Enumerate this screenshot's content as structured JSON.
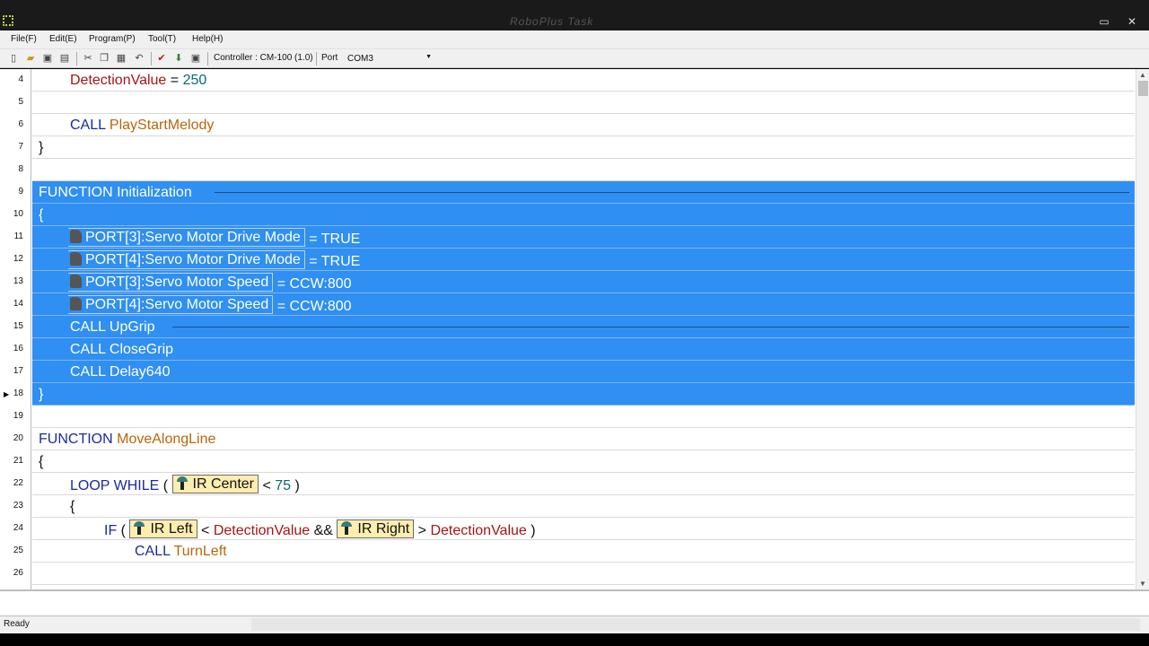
{
  "window": {
    "title": "RoboPlus Task"
  },
  "menu": [
    {
      "label": "File(F)"
    },
    {
      "label": "Edit(E)"
    },
    {
      "label": "Program(P)"
    },
    {
      "label": "Tool(T)"
    },
    {
      "label": "Help(H)"
    }
  ],
  "toolbar": {
    "controller_label": "Controller : CM-100 (1.0)",
    "port_label": "Port",
    "port_value": "COM3"
  },
  "editor": {
    "lines": [
      {
        "n": "4",
        "parts": [
          {
            "t": "DetectionValue",
            "c": "var"
          },
          {
            "t": " = ",
            "c": "op"
          },
          {
            "t": "250",
            "c": "num"
          }
        ]
      },
      {
        "n": "5",
        "parts": []
      },
      {
        "n": "6",
        "parts": [
          {
            "t": "CALL",
            "c": "kw"
          },
          {
            "t": "PlayStartMelody",
            "c": "fn"
          }
        ]
      },
      {
        "n": "7",
        "parts": [
          {
            "t": "}",
            "c": "op"
          }
        ]
      },
      {
        "n": "8",
        "parts": []
      },
      {
        "n": "9",
        "parts": [
          {
            "t": "FUNCTION",
            "c": "kw"
          },
          {
            "t": "Initialization",
            "c": "fn"
          }
        ]
      },
      {
        "n": "10",
        "parts": [
          {
            "t": "{",
            "c": "op"
          }
        ]
      },
      {
        "n": "11",
        "parts": [
          {
            "t": "PORT[3]:Servo Motor Drive Mode",
            "c": "chip"
          },
          {
            "t": " = TRUE",
            "c": "op"
          }
        ]
      },
      {
        "n": "12",
        "parts": [
          {
            "t": "PORT[4]:Servo Motor Drive Mode",
            "c": "chip"
          },
          {
            "t": " = TRUE",
            "c": "op"
          }
        ]
      },
      {
        "n": "13",
        "parts": [
          {
            "t": "PORT[3]:Servo Motor Speed",
            "c": "chip"
          },
          {
            "t": " = CCW:800",
            "c": "op"
          }
        ]
      },
      {
        "n": "14",
        "parts": [
          {
            "t": "PORT[4]:Servo Motor Speed",
            "c": "chip"
          },
          {
            "t": " = CCW:800",
            "c": "op"
          }
        ]
      },
      {
        "n": "15",
        "parts": [
          {
            "t": "CALL",
            "c": "kw"
          },
          {
            "t": "UpGrip",
            "c": "fn"
          }
        ]
      },
      {
        "n": "16",
        "parts": [
          {
            "t": "CALL",
            "c": "kw"
          },
          {
            "t": "CloseGrip",
            "c": "fn"
          }
        ]
      },
      {
        "n": "17",
        "parts": [
          {
            "t": "CALL",
            "c": "kw"
          },
          {
            "t": "Delay640",
            "c": "fn"
          }
        ]
      },
      {
        "n": "18",
        "parts": [
          {
            "t": "}",
            "c": "op"
          }
        ]
      },
      {
        "n": "19",
        "parts": []
      },
      {
        "n": "20",
        "parts": [
          {
            "t": "FUNCTION",
            "c": "kw"
          },
          {
            "t": "MoveAlongLine",
            "c": "fn"
          }
        ]
      },
      {
        "n": "21",
        "parts": [
          {
            "t": "{",
            "c": "op"
          }
        ]
      },
      {
        "n": "22",
        "parts": [
          {
            "t": "LOOP WHILE",
            "c": "kw"
          },
          {
            "t": "(",
            "c": "op"
          },
          {
            "t": "IR Center",
            "c": "sensor"
          },
          {
            "t": "<",
            "c": "op"
          },
          {
            "t": "75",
            "c": "num"
          },
          {
            "t": ")",
            "c": "op"
          }
        ]
      },
      {
        "n": "23",
        "parts": [
          {
            "t": "{",
            "c": "op"
          }
        ]
      },
      {
        "n": "24",
        "parts": [
          {
            "t": "IF",
            "c": "kw"
          },
          {
            "t": "(",
            "c": "op"
          },
          {
            "t": "IR Left",
            "c": "sensor"
          },
          {
            "t": "<",
            "c": "op"
          },
          {
            "t": "DetectionValue",
            "c": "var"
          },
          {
            "t": "&&",
            "c": "op"
          },
          {
            "t": "IR Right",
            "c": "sensor"
          },
          {
            "t": ">",
            "c": "op"
          },
          {
            "t": "DetectionValue",
            "c": "var"
          },
          {
            "t": ")",
            "c": "op"
          }
        ]
      },
      {
        "n": "25",
        "parts": [
          {
            "t": "CALL",
            "c": "kw"
          },
          {
            "t": "TurnLeft",
            "c": "fn"
          }
        ]
      },
      {
        "n": "26",
        "parts": []
      }
    ]
  },
  "status": {
    "text": "Ready"
  },
  "colors": {
    "selection": "#2f8ff2",
    "keyword": "#1a2a9c",
    "function": "#b8660b",
    "variable": "#a31515",
    "number": "#0a6b6b"
  }
}
